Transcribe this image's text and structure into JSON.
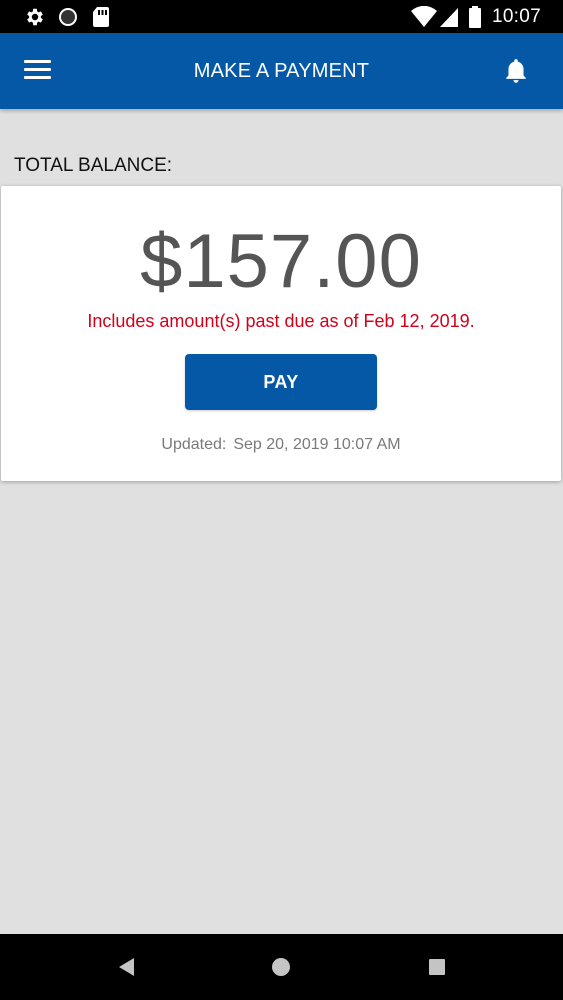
{
  "status_bar": {
    "time": "10:07",
    "icons": [
      "settings-icon",
      "circle-icon",
      "sd-card-icon",
      "wifi-icon",
      "signal-icon",
      "battery-icon"
    ]
  },
  "app_bar": {
    "title": "MAKE A PAYMENT",
    "menu_icon": "hamburger-menu-icon",
    "notification_icon": "bell-icon",
    "color": "#0458a6"
  },
  "balance": {
    "label": "TOTAL BALANCE:",
    "amount": "$157.00",
    "past_due_notice": "Includes amount(s) past due as of Feb 12, 2019.",
    "pay_button_label": "PAY",
    "updated_label": "Updated:",
    "updated_value": "Sep 20, 2019 10:07 AM",
    "alert_color": "#d0021b"
  },
  "nav_bar": {
    "buttons": [
      "back-icon",
      "home-icon",
      "recents-icon"
    ]
  }
}
